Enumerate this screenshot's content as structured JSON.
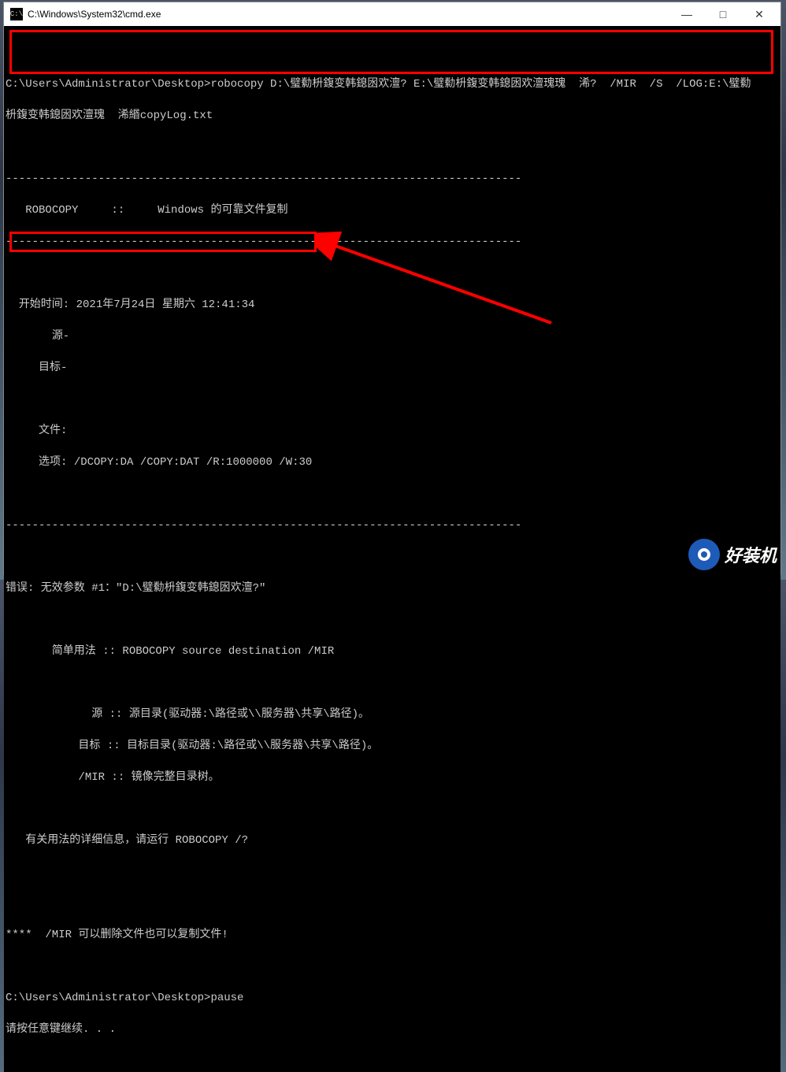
{
  "titlebar": {
    "icon_text": "C:\\",
    "title": "C:\\Windows\\System32\\cmd.exe",
    "minimize": "—",
    "maximize": "□",
    "close": "✕"
  },
  "terminal": {
    "l1": "",
    "l2": "C:\\Users\\Administrator\\Desktop>robocopy D:\\璧勬枡鍑变韩鎴囦欢澶? E:\\璧勬枡鍑变韩鎴囦欢澶瑰瑰  浠?  /MIR  /S  /LOG:E:\\璧勬",
    "l3": "枡鍑变韩鎴囦欢澶瑰  浠緡copyLog.txt",
    "l4": "",
    "l5": "------------------------------------------------------------------------------",
    "l6": "   ROBOCOPY     ::     Windows 的可靠文件复制",
    "l7": "------------------------------------------------------------------------------",
    "l8": "",
    "l9": "  开始时间: 2021年7月24日 星期六 12:41:34",
    "l10": "       源-",
    "l11": "     目标-",
    "l12": "",
    "l13": "     文件:",
    "l14": "     选项: /DCOPY:DA /COPY:DAT /R:1000000 /W:30",
    "l15": "",
    "l16": "------------------------------------------------------------------------------",
    "l17": "",
    "l18": "错误: 无效参数 #1：\"D:\\璧勬枡鍑变韩鎴囦欢澶?\"",
    "l19": "",
    "l20": "       简单用法 :: ROBOCOPY source destination /MIR",
    "l21": "",
    "l22": "             源 :: 源目录(驱动器:\\路径或\\\\服务器\\共享\\路径)。",
    "l23": "           目标 :: 目标目录(驱动器:\\路径或\\\\服务器\\共享\\路径)。",
    "l24": "           /MIR :: 镜像完整目录树。",
    "l25": "",
    "l26": "   有关用法的详细信息，请运行 ROBOCOPY /?",
    "l27": "",
    "l28": "",
    "l29": "****  /MIR 可以删除文件也可以复制文件!",
    "l30": "",
    "l31": "C:\\Users\\Administrator\\Desktop>pause",
    "l32": "请按任意键继续. . ."
  },
  "watermark": {
    "text": "好装机"
  }
}
